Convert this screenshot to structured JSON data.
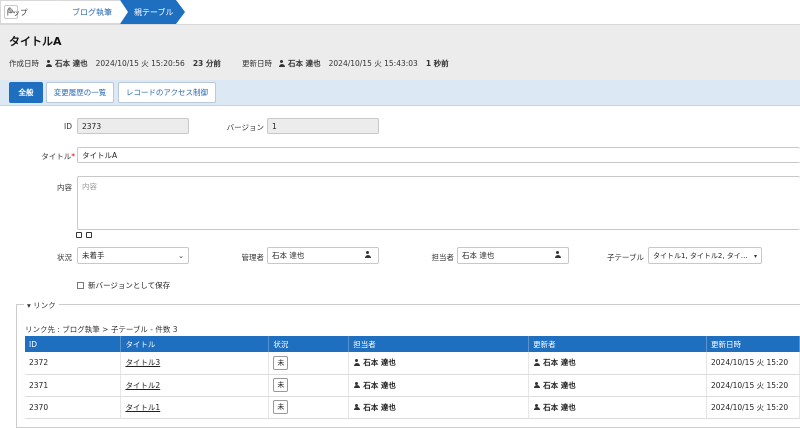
{
  "breadcrumb": {
    "home": "トップ",
    "site": "ブログ執筆",
    "current": "親テーブル"
  },
  "header": {
    "title": "タイトルA",
    "created_label": "作成日時",
    "created_user": "石本 達也",
    "created_at": "2024/10/15 火 15:20:56",
    "created_ago": "23 分前",
    "updated_label": "更新日時",
    "updated_user": "石本 達也",
    "updated_at": "2024/10/15 火 15:43:03",
    "updated_ago": "1 秒前"
  },
  "tabs": [
    "全般",
    "変更履歴の一覧",
    "レコードのアクセス制御"
  ],
  "form": {
    "id_label": "ID",
    "id_value": "2373",
    "version_label": "バージョン",
    "version_value": "1",
    "title_label": "タイトル",
    "title_req": "*",
    "title_value": "タイトルA",
    "body_label": "内容",
    "body_placeholder": "内容",
    "status_label": "状況",
    "status_value": "未着手",
    "manager_label": "管理者",
    "manager_value": "石本 達也",
    "owner_label": "担当者",
    "owner_value": "石本 達也",
    "child_label": "子テーブル",
    "child_value": "タイトル1, タイトル2, タイ…",
    "save_new_version": "新バージョンとして保存"
  },
  "links": {
    "legend": "▾ リンク",
    "caption": "リンク先 : ブログ執筆 > 子テーブル - 件数 3",
    "columns": [
      "ID",
      "タイトル",
      "状況",
      "担当者",
      "更新者",
      "更新日時"
    ],
    "rows": [
      {
        "id": "2372",
        "title": "タイトル3",
        "status": "未",
        "owner": "石本 達也",
        "updater": "石本 達也",
        "updated": "2024/10/15 火 15:20"
      },
      {
        "id": "2371",
        "title": "タイトル2",
        "status": "未",
        "owner": "石本 達也",
        "updater": "石本 達也",
        "updated": "2024/10/15 火 15:20"
      },
      {
        "id": "2370",
        "title": "タイトル1",
        "status": "未",
        "owner": "石本 達也",
        "updater": "石本 達也",
        "updated": "2024/10/15 火 15:20"
      }
    ]
  },
  "colors": {
    "accent": "#1e6fc0",
    "header_bg": "#ececec",
    "tabbar_bg": "#dce8f4"
  },
  "icons": {
    "home": "pin-icon",
    "user": "user-icon",
    "dropdown": "chevron-down-icon"
  }
}
